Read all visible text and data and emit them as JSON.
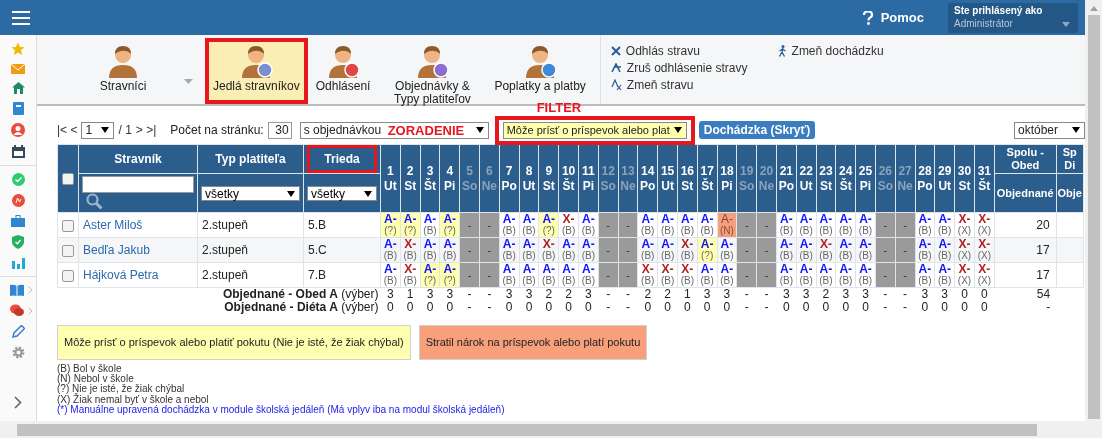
{
  "topbar": {
    "help": "Pomoc",
    "user_caption": "Ste prihlásený ako",
    "user_name": "Administrátor"
  },
  "toolbar": {
    "buttons": [
      {
        "label": "Stravníci",
        "kind": "plain",
        "selected": false,
        "highlighted": false,
        "dropdown": true
      },
      {
        "label": "Jedlá stravníkov",
        "kind": "meals",
        "selected": true,
        "highlighted": true,
        "dropdown": false
      },
      {
        "label": "Odhlásení",
        "kind": "cancel",
        "selected": false,
        "highlighted": false,
        "dropdown": false
      },
      {
        "label": "Objednávky & Typy platiteľov",
        "kind": "gear",
        "selected": false,
        "highlighted": false,
        "dropdown": false
      },
      {
        "label": "Poplatky a platby",
        "kind": "euro",
        "selected": false,
        "highlighted": false,
        "dropdown": false
      }
    ],
    "actions": [
      {
        "label": "Odhlás stravu",
        "kind": "cross"
      },
      {
        "label": "Zruš odhlásenie stravy",
        "kind": "undo"
      },
      {
        "label": "Zmeň stravu",
        "kind": "swap"
      },
      {
        "label": "Zmeň dochádzku",
        "kind": "walk"
      }
    ]
  },
  "controls": {
    "first_prev": "|< <",
    "page": "1",
    "page_total": "/ 1",
    "next_last": "> >|",
    "per_page_label": "Počet na stránku:",
    "per_page": "30",
    "sort": {
      "value": "s objednávkou",
      "annotation": "ZORADENIE"
    },
    "filter": {
      "value": "Môže prísť o príspevok alebo plat",
      "annotation": "FILTER",
      "highlighted": true
    },
    "attendance_button": "Dochádzka (Skryť)",
    "month": "október"
  },
  "table": {
    "select_all": {
      "checked": false
    },
    "columns": [
      {
        "label": "Stravník",
        "highlighted": false,
        "kind": "search"
      },
      {
        "label": "Typ platiteľa",
        "highlighted": false,
        "kind": "select",
        "value": "všetky"
      },
      {
        "label": "Trieda",
        "highlighted": true,
        "kind": "select",
        "value": "všetky"
      }
    ],
    "days": [
      {
        "num": "1",
        "wd": "Ut",
        "weekend": false
      },
      {
        "num": "2",
        "wd": "St",
        "weekend": false
      },
      {
        "num": "3",
        "wd": "Št",
        "weekend": false
      },
      {
        "num": "4",
        "wd": "Pi",
        "weekend": false
      },
      {
        "num": "5",
        "wd": "So",
        "weekend": true
      },
      {
        "num": "6",
        "wd": "Ne",
        "weekend": true
      },
      {
        "num": "7",
        "wd": "Po",
        "weekend": false
      },
      {
        "num": "8",
        "wd": "Ut",
        "weekend": false
      },
      {
        "num": "9",
        "wd": "St",
        "weekend": false
      },
      {
        "num": "10",
        "wd": "Št",
        "weekend": false
      },
      {
        "num": "11",
        "wd": "Pi",
        "weekend": false
      },
      {
        "num": "12",
        "wd": "So",
        "weekend": true
      },
      {
        "num": "13",
        "wd": "Ne",
        "weekend": true
      },
      {
        "num": "14",
        "wd": "Po",
        "weekend": false
      },
      {
        "num": "15",
        "wd": "Ut",
        "weekend": false
      },
      {
        "num": "16",
        "wd": "St",
        "weekend": false
      },
      {
        "num": "17",
        "wd": "Št",
        "weekend": false
      },
      {
        "num": "18",
        "wd": "Pi",
        "weekend": false
      },
      {
        "num": "19",
        "wd": "So",
        "weekend": true
      },
      {
        "num": "20",
        "wd": "Ne",
        "weekend": true
      },
      {
        "num": "21",
        "wd": "Po",
        "weekend": false
      },
      {
        "num": "22",
        "wd": "Ut",
        "weekend": false
      },
      {
        "num": "23",
        "wd": "St",
        "weekend": false
      },
      {
        "num": "24",
        "wd": "Št",
        "weekend": false
      },
      {
        "num": "25",
        "wd": "Pi",
        "weekend": false
      },
      {
        "num": "26",
        "wd": "So",
        "weekend": true
      },
      {
        "num": "27",
        "wd": "Ne",
        "weekend": true
      },
      {
        "num": "28",
        "wd": "Po",
        "weekend": false
      },
      {
        "num": "29",
        "wd": "Ut",
        "weekend": false
      },
      {
        "num": "30",
        "wd": "St",
        "weekend": false
      },
      {
        "num": "31",
        "wd": "Št",
        "weekend": false
      }
    ],
    "summary_columns": [
      {
        "top": "Spolu - Obed",
        "sub": "Objednané"
      },
      {
        "top": "Sp Di",
        "sub": "Obje"
      }
    ],
    "rows": [
      {
        "checked": false,
        "name": "Aster Miloš",
        "payer": "2.stupeň",
        "class": "5.B",
        "total": "20",
        "cells": [
          {
            "kind": "unsure",
            "meal": "A-",
            "att": "(?)",
            "cancelled": false
          },
          {
            "kind": "unsure",
            "meal": "A-",
            "att": "(?)",
            "cancelled": false
          },
          {
            "kind": "present",
            "meal": "A-",
            "att": "(B)",
            "cancelled": false
          },
          {
            "kind": "unsure",
            "meal": "A-",
            "att": "(?)",
            "cancelled": false
          },
          {
            "kind": "weekend",
            "text": "-"
          },
          {
            "kind": "weekend",
            "text": "-"
          },
          {
            "kind": "present",
            "meal": "A-",
            "att": "(B)",
            "cancelled": false
          },
          {
            "kind": "present",
            "meal": "A-",
            "att": "(B)",
            "cancelled": false
          },
          {
            "kind": "unsure",
            "meal": "A-",
            "att": "(?)",
            "cancelled": false
          },
          {
            "kind": "present",
            "meal": "X-",
            "att": "(B)",
            "cancelled": true
          },
          {
            "kind": "present",
            "meal": "A-",
            "att": "(B)",
            "cancelled": false
          },
          {
            "kind": "weekend",
            "text": "-"
          },
          {
            "kind": "weekend",
            "text": "-"
          },
          {
            "kind": "present",
            "meal": "A-",
            "att": "(B)",
            "cancelled": false
          },
          {
            "kind": "present",
            "meal": "A-",
            "att": "(B)",
            "cancelled": false
          },
          {
            "kind": "present",
            "meal": "A-",
            "att": "(B)",
            "cancelled": false
          },
          {
            "kind": "present",
            "meal": "A-",
            "att": "(B)",
            "cancelled": false
          },
          {
            "kind": "lost",
            "meal": "A-",
            "att": "(N)",
            "cancelled": false
          },
          {
            "kind": "weekend",
            "text": "-"
          },
          {
            "kind": "weekend",
            "text": "-"
          },
          {
            "kind": "present",
            "meal": "A-",
            "att": "(B)",
            "cancelled": false
          },
          {
            "kind": "present",
            "meal": "A-",
            "att": "(B)",
            "cancelled": false
          },
          {
            "kind": "present",
            "meal": "A-",
            "att": "(B)",
            "cancelled": false
          },
          {
            "kind": "present",
            "meal": "A-",
            "att": "(B)",
            "cancelled": false
          },
          {
            "kind": "present",
            "meal": "A-",
            "att": "(B)",
            "cancelled": false
          },
          {
            "kind": "weekend",
            "text": "-"
          },
          {
            "kind": "weekend",
            "text": "-"
          },
          {
            "kind": "present",
            "meal": "A-",
            "att": "(B)",
            "cancelled": false
          },
          {
            "kind": "present",
            "meal": "A-",
            "att": "(B)",
            "cancelled": false
          },
          {
            "kind": "present",
            "meal": "X-",
            "att": "(X)",
            "cancelled": true
          },
          {
            "kind": "present",
            "meal": "X-",
            "att": "(X)",
            "cancelled": true
          }
        ]
      },
      {
        "checked": false,
        "name": "Bedľa Jakub",
        "payer": "2.stupeň",
        "class": "5.C",
        "total": "17",
        "cells": [
          {
            "kind": "present",
            "meal": "A-",
            "att": "(B)",
            "cancelled": false
          },
          {
            "kind": "present",
            "meal": "X-",
            "att": "(B)",
            "cancelled": true
          },
          {
            "kind": "present",
            "meal": "A-",
            "att": "(B)",
            "cancelled": false
          },
          {
            "kind": "present",
            "meal": "A-",
            "att": "(B)",
            "cancelled": false
          },
          {
            "kind": "weekend",
            "text": "-"
          },
          {
            "kind": "weekend",
            "text": "-"
          },
          {
            "kind": "present",
            "meal": "A-",
            "att": "(B)",
            "cancelled": false
          },
          {
            "kind": "present",
            "meal": "A-",
            "att": "(B)",
            "cancelled": false
          },
          {
            "kind": "present",
            "meal": "X-",
            "att": "(B)",
            "cancelled": true
          },
          {
            "kind": "present",
            "meal": "A-",
            "att": "(B)",
            "cancelled": false
          },
          {
            "kind": "present",
            "meal": "A-",
            "att": "(B)",
            "cancelled": false
          },
          {
            "kind": "weekend",
            "text": "-"
          },
          {
            "kind": "weekend",
            "text": "-"
          },
          {
            "kind": "present",
            "meal": "A-",
            "att": "(B)",
            "cancelled": false
          },
          {
            "kind": "present",
            "meal": "A-",
            "att": "(B)",
            "cancelled": false
          },
          {
            "kind": "present",
            "meal": "X-",
            "att": "(B)",
            "cancelled": true
          },
          {
            "kind": "unsure",
            "meal": "A-",
            "att": "(?)",
            "cancelled": false
          },
          {
            "kind": "present",
            "meal": "A-",
            "att": "(B)",
            "cancelled": false
          },
          {
            "kind": "weekend",
            "text": "-"
          },
          {
            "kind": "weekend",
            "text": "-"
          },
          {
            "kind": "present",
            "meal": "A-",
            "att": "(B)",
            "cancelled": false
          },
          {
            "kind": "present",
            "meal": "A-",
            "att": "(B)",
            "cancelled": false
          },
          {
            "kind": "present",
            "meal": "X-",
            "att": "(B)",
            "cancelled": true
          },
          {
            "kind": "present",
            "meal": "A-",
            "att": "(B)",
            "cancelled": false
          },
          {
            "kind": "present",
            "meal": "A-",
            "att": "(B)",
            "cancelled": false
          },
          {
            "kind": "weekend",
            "text": "-"
          },
          {
            "kind": "weekend",
            "text": "-"
          },
          {
            "kind": "present",
            "meal": "A-",
            "att": "(B)",
            "cancelled": false
          },
          {
            "kind": "present",
            "meal": "A-",
            "att": "(B)",
            "cancelled": false
          },
          {
            "kind": "present",
            "meal": "X-",
            "att": "(X)",
            "cancelled": true
          },
          {
            "kind": "present",
            "meal": "X-",
            "att": "(X)",
            "cancelled": true
          }
        ]
      },
      {
        "checked": false,
        "name": "Hájková Petra",
        "payer": "2.stupeň",
        "class": "7.B",
        "total": "17",
        "cells": [
          {
            "kind": "present",
            "meal": "A-",
            "att": "(B)",
            "cancelled": false
          },
          {
            "kind": "present",
            "meal": "X-",
            "att": "(B)",
            "cancelled": true
          },
          {
            "kind": "unsure",
            "meal": "A-",
            "att": "(?)",
            "cancelled": false
          },
          {
            "kind": "unsure",
            "meal": "A-",
            "att": "(?)",
            "cancelled": false
          },
          {
            "kind": "weekend",
            "text": "-"
          },
          {
            "kind": "weekend",
            "text": "-"
          },
          {
            "kind": "present",
            "meal": "A-",
            "att": "(B)",
            "cancelled": false
          },
          {
            "kind": "present",
            "meal": "A-",
            "att": "(B)",
            "cancelled": false
          },
          {
            "kind": "present",
            "meal": "A-",
            "att": "(B)",
            "cancelled": false
          },
          {
            "kind": "present",
            "meal": "A-",
            "att": "(B)",
            "cancelled": false
          },
          {
            "kind": "present",
            "meal": "A-",
            "att": "(B)",
            "cancelled": false
          },
          {
            "kind": "weekend",
            "text": "-"
          },
          {
            "kind": "weekend",
            "text": "-"
          },
          {
            "kind": "present",
            "meal": "X-",
            "att": "(B)",
            "cancelled": true
          },
          {
            "kind": "present",
            "meal": "X-",
            "att": "(B)",
            "cancelled": true
          },
          {
            "kind": "present",
            "meal": "X-",
            "att": "(B)",
            "cancelled": true
          },
          {
            "kind": "present",
            "meal": "A-",
            "att": "(B)",
            "cancelled": false
          },
          {
            "kind": "present",
            "meal": "A-",
            "att": "(B)",
            "cancelled": false
          },
          {
            "kind": "weekend",
            "text": "-"
          },
          {
            "kind": "weekend",
            "text": "-"
          },
          {
            "kind": "present",
            "meal": "A-",
            "att": "(B)",
            "cancelled": false
          },
          {
            "kind": "present",
            "meal": "A-",
            "att": "(B)",
            "cancelled": false
          },
          {
            "kind": "present",
            "meal": "A-",
            "att": "(B)",
            "cancelled": false
          },
          {
            "kind": "present",
            "meal": "A-",
            "att": "(B)",
            "cancelled": false
          },
          {
            "kind": "present",
            "meal": "A-",
            "att": "(B)",
            "cancelled": false
          },
          {
            "kind": "weekend",
            "text": "-"
          },
          {
            "kind": "weekend",
            "text": "-"
          },
          {
            "kind": "present",
            "meal": "A-",
            "att": "(B)",
            "cancelled": false
          },
          {
            "kind": "present",
            "meal": "A-",
            "att": "(B)",
            "cancelled": false
          },
          {
            "kind": "present",
            "meal": "X-",
            "att": "(X)",
            "cancelled": true
          },
          {
            "kind": "present",
            "meal": "X-",
            "att": "(X)",
            "cancelled": true
          }
        ]
      }
    ],
    "totals": [
      {
        "label": "Objednané - Obed A",
        "note": "(výber)",
        "values": [
          "3",
          "1",
          "3",
          "3",
          "-",
          "-",
          "3",
          "3",
          "2",
          "2",
          "3",
          "-",
          "-",
          "2",
          "2",
          "1",
          "3",
          "3",
          "-",
          "-",
          "3",
          "3",
          "2",
          "3",
          "3",
          "-",
          "-",
          "3",
          "3",
          "0",
          "0"
        ],
        "total": "54"
      },
      {
        "label": "Objednané - Diéta A",
        "note": "(výber)",
        "values": [
          "0",
          "0",
          "0",
          "0",
          "-",
          "-",
          "0",
          "0",
          "0",
          "0",
          "0",
          "-",
          "-",
          "0",
          "0",
          "0",
          "0",
          "0",
          "-",
          "-",
          "0",
          "0",
          "0",
          "0",
          "0",
          "-",
          "-",
          "0",
          "0",
          "0",
          "0"
        ],
        "total": "-"
      }
    ]
  },
  "legend_boxes": [
    {
      "text": "Môže prísť o príspevok alebo platiť pokutu (Nie je isté, že žiak chýbal)",
      "kind": "unsure"
    },
    {
      "text": "Stratil nárok na príspevok alebo platí pokutu",
      "kind": "lost"
    }
  ],
  "legend_notes": [
    {
      "text": "(B) Bol v škole",
      "kind": "plain"
    },
    {
      "text": "(N) Nebol v škole",
      "kind": "plain"
    },
    {
      "text": "(?) Nie je isté, že žiak chýbal",
      "kind": "plain"
    },
    {
      "text": "(X) Žiak nemal byť v škole a nebol",
      "kind": "plain"
    },
    {
      "text": "(*) Manuálne upravená dochádzka v module školská jedáleň (Má vplyv iba na modul školská jedáleň)",
      "kind": "manual"
    }
  ]
}
